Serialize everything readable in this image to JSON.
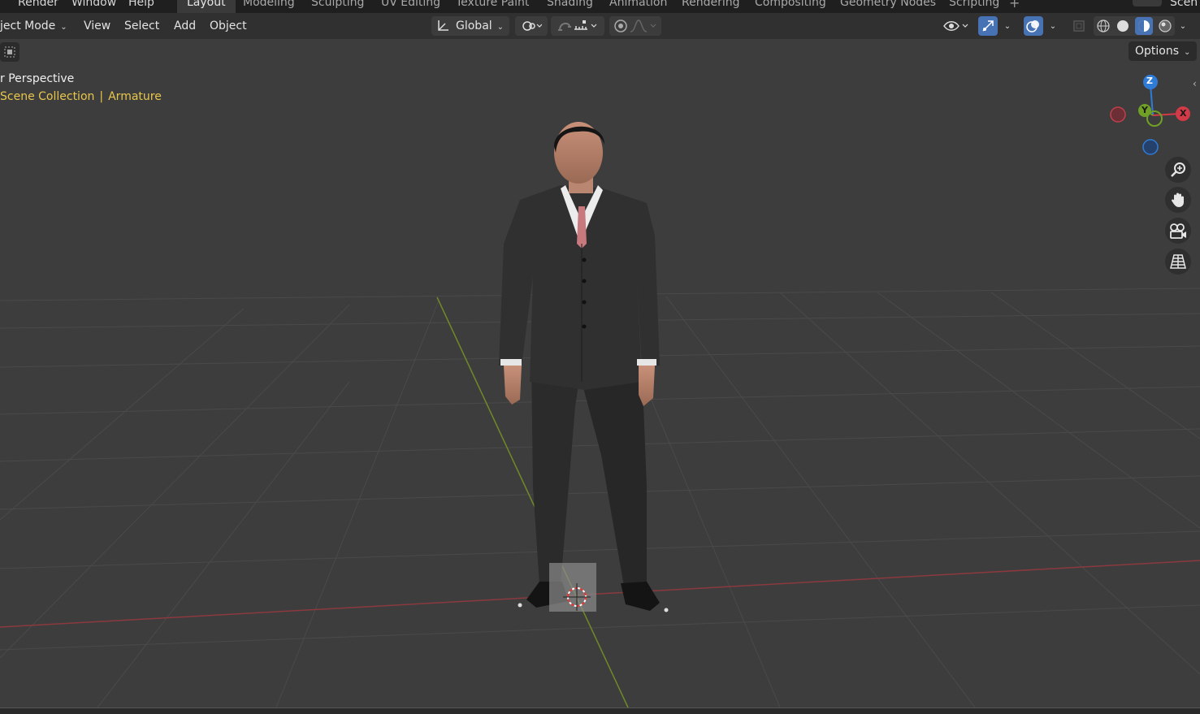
{
  "topbar": {
    "menus": [
      "Render",
      "Window",
      "Help"
    ],
    "tabs": [
      "Layout",
      "Modeling",
      "Sculpting",
      "UV Editing",
      "Texture Paint",
      "Shading",
      "Animation",
      "Rendering",
      "Compositing",
      "Geometry Nodes",
      "Scripting"
    ],
    "active_tab": "Layout",
    "scene_label": "Scen"
  },
  "header": {
    "mode": "ject Mode",
    "menu": [
      "View",
      "Select",
      "Add",
      "Object"
    ],
    "transform_orientation": "Global"
  },
  "viewport": {
    "view_title": "r Perspective",
    "collection": "Scene Collection",
    "active_object": "Armature",
    "options_label": "Options"
  },
  "gizmo": {
    "axes": [
      "Z",
      "Y",
      "X"
    ],
    "colors": {
      "x": "#d23a47",
      "y": "#70a026",
      "z": "#2f7bd8"
    }
  },
  "icons": {
    "header": [
      "transform-orientation-icon",
      "pivot-icon",
      "snap-icon",
      "snap-increment-icon",
      "proportional-edit-icon",
      "falloff-icon",
      "visibility-icon",
      "gizmo-icon",
      "overlay-icon",
      "xray-icon",
      "wireframe-shading-icon",
      "solid-shading-icon",
      "material-shading-icon",
      "rendered-shading-icon"
    ],
    "navigation": [
      "zoom-icon",
      "pan-hand-icon",
      "camera-icon",
      "perspective-grid-icon"
    ]
  }
}
